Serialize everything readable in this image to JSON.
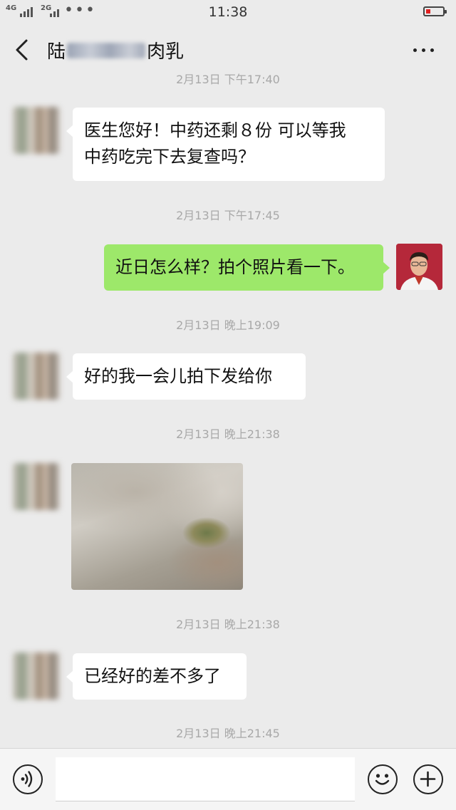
{
  "status_bar": {
    "network_1": "4G",
    "network_2": "2G",
    "overflow_dots": "•••",
    "time": "11:38",
    "battery_color": "#e02020"
  },
  "header": {
    "title_prefix": "陆",
    "title_suffix": "肉乳",
    "back_icon": "chevron-left-icon",
    "more_icon": "more-dots-icon"
  },
  "messages": [
    {
      "type": "time",
      "text": "2月13日 下午17:40"
    },
    {
      "side": "left",
      "lines": [
        "医生您好！中药还剩８份  可以等我",
        "中药吃完下去复查吗？"
      ]
    },
    {
      "type": "time",
      "text": "2月13日 下午17:45"
    },
    {
      "side": "right",
      "lines": [
        "近日怎么样？拍个照片看一下。"
      ]
    },
    {
      "type": "time",
      "text": "2月13日 晚上19:09"
    },
    {
      "side": "left",
      "lines": [
        "好的我一会儿拍下发给你"
      ]
    },
    {
      "type": "time",
      "text": "2月13日 晚上21:38"
    },
    {
      "side": "left",
      "image": "photo"
    },
    {
      "type": "time",
      "text": "2月13日 晚上21:38"
    },
    {
      "side": "left",
      "lines": [
        "已经好的差不多了"
      ]
    },
    {
      "type": "time",
      "text": "2月13日 晚上21:45"
    }
  ],
  "input_bar": {
    "voice_icon": "voice-icon",
    "emoji_icon": "emoji-icon",
    "plus_icon": "plus-icon",
    "placeholder": ""
  },
  "colors": {
    "background": "#ebebeb",
    "bubble_left": "#ffffff",
    "bubble_right": "#9de86a",
    "timestamp": "#a8a8a8"
  }
}
